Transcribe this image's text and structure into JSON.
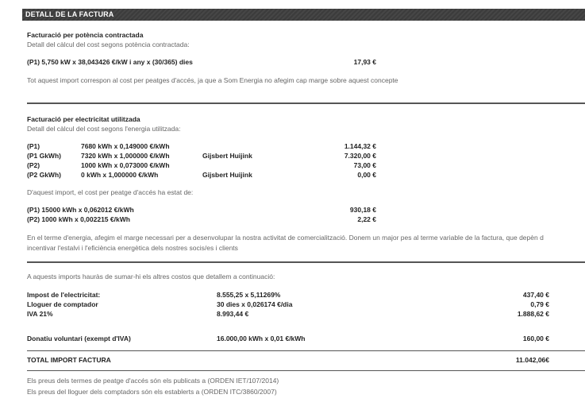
{
  "header": {
    "title": "DETALL DE LA FACTURA"
  },
  "power": {
    "title": "Facturació per potència contractada",
    "subtitle": "Detall del càlcul del cost segons potència contractada:",
    "line": "(P1) 5,750 kW x 38,043426 €/kW i any x (30/365) dies",
    "amount": "17,93 €",
    "note": "Tot aquest import correspon al cost per peatges d'accés, ja que a Som Energia no afegim cap marge sobre aquest concepte"
  },
  "energy": {
    "title": "Facturació per electricitat utilitzada",
    "subtitle": "Detall del càlcul del cost segons l'energia utilitzada:",
    "rows": [
      {
        "period": "(P1)",
        "calc": "7680 kWh x 0,149000 €/kWh",
        "name": "",
        "amount": "1.144,32 €"
      },
      {
        "period": "(P1 GkWh)",
        "calc": "7320 kWh x 1,000000 €/kWh",
        "name": "Gijsbert Huijink",
        "amount": "7.320,00 €"
      },
      {
        "period": "(P2)",
        "calc": "1000 kWh x 0,073000 €/kWh",
        "name": "",
        "amount": "73,00 €"
      },
      {
        "period": "(P2 GkWh)",
        "calc": "0 kWh x 1,000000 €/kWh",
        "name": "Gijsbert Huijink",
        "amount": "0,00 €"
      }
    ],
    "toll_intro": "D'aquest import, el cost per peatge d'accés ha estat de:",
    "toll_rows": [
      {
        "calc": "(P1) 15000 kWh x 0,062012 €/kWh",
        "amount": "930,18 €"
      },
      {
        "calc": "(P2) 1000 kWh x 0,002215 €/kWh",
        "amount": "2,22 €"
      }
    ],
    "note_line1": "En el terme d'energia, afegim el marge necessari per a desenvolupar la nostra activitat de comercialització. Donem un major pes al terme variable de la factura, que depèn d",
    "note_line2": "incentivar l'estalvi i l'eficiència energètica dels nostres socis/es i clients"
  },
  "other": {
    "intro": "A aquests imports hauràs de sumar-hi els altres costos que detallem a continuació:",
    "rows": [
      {
        "label": "Impost de l'electricitat:",
        "calc": "8.555,25 x 5,11269%",
        "amount": "437,40 €"
      },
      {
        "label": "Lloguer de comptador",
        "calc": "30 dies x 0,026174 €/dia",
        "amount": "0,79 €"
      },
      {
        "label": "IVA 21%",
        "calc": "8.993,44 €",
        "amount": "1.888,62 €"
      }
    ],
    "donation": {
      "label": "Donatiu voluntari (exempt d'IVA)",
      "calc": "16.000,00 kWh x 0,01 €/kWh",
      "amount": "160,00 €"
    }
  },
  "total": {
    "label": "TOTAL IMPORT FACTURA",
    "amount": "11.042,06€"
  },
  "footer": {
    "line1": "Els preus dels termes de peatge d'accés són els publicats a (ORDEN IET/107/2014)",
    "line2": "Els preus del lloguer dels comptadors són els establerts a (ORDEN ITC/3860/2007)"
  }
}
